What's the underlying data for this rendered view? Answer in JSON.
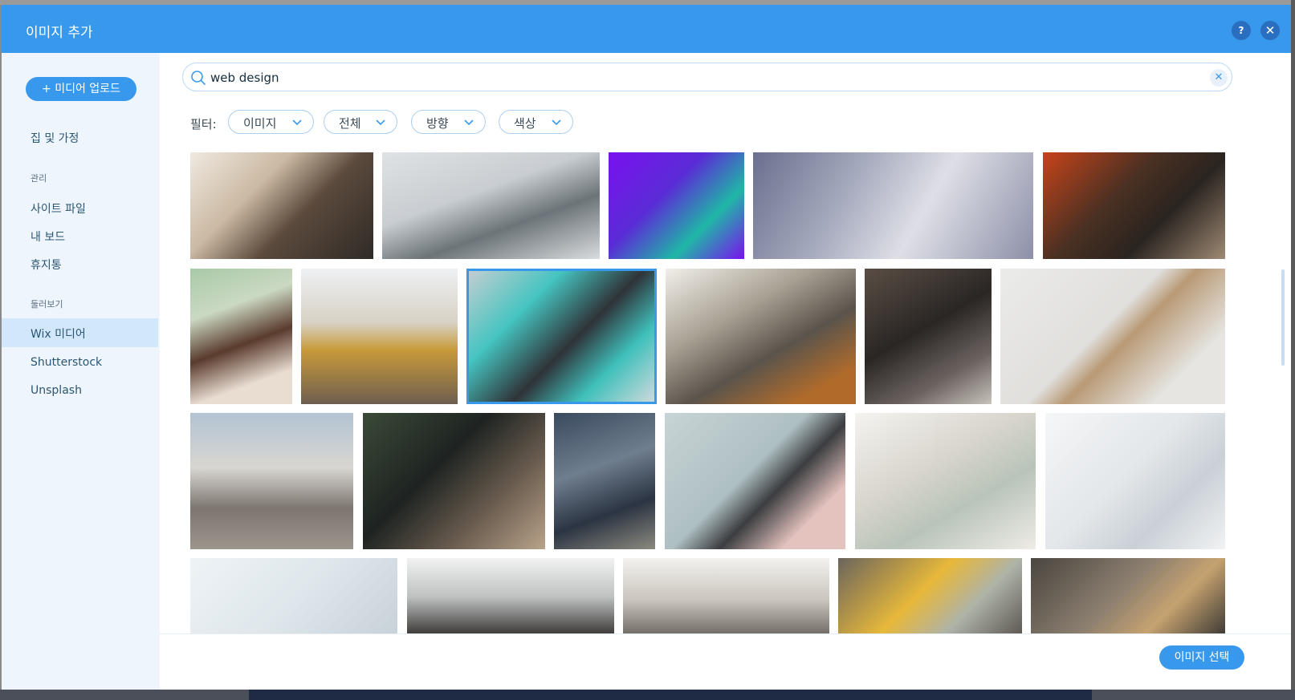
{
  "header": {
    "title": "이미지 추가",
    "help_label": "?",
    "close_label": "✕"
  },
  "sidebar": {
    "upload_label": "+ 미디어 업로드",
    "home_label": "집 및 가정",
    "manage_heading": "관리",
    "site_files": "사이트 파일",
    "my_boards": "내 보드",
    "trash": "휴지통",
    "browse_heading": "둘러보기",
    "wix_media": "Wix 미디어",
    "shutterstock": "Shutterstock",
    "unsplash": "Unsplash"
  },
  "search": {
    "value": "web design",
    "clear_label": "✕"
  },
  "filters": {
    "label": "필터:",
    "items": [
      {
        "label": "이미지"
      },
      {
        "label": "전체"
      },
      {
        "label": "방향"
      },
      {
        "label": "색상"
      }
    ]
  },
  "footer": {
    "select_label": "이미지 선택"
  },
  "colors": {
    "accent": "#3899ec",
    "sidebar_bg": "#eef5fd",
    "active_bg": "#d3e7fb"
  },
  "icons": {
    "search": "search-icon",
    "chevron": "chevron-down-icon",
    "close": "close-icon"
  }
}
